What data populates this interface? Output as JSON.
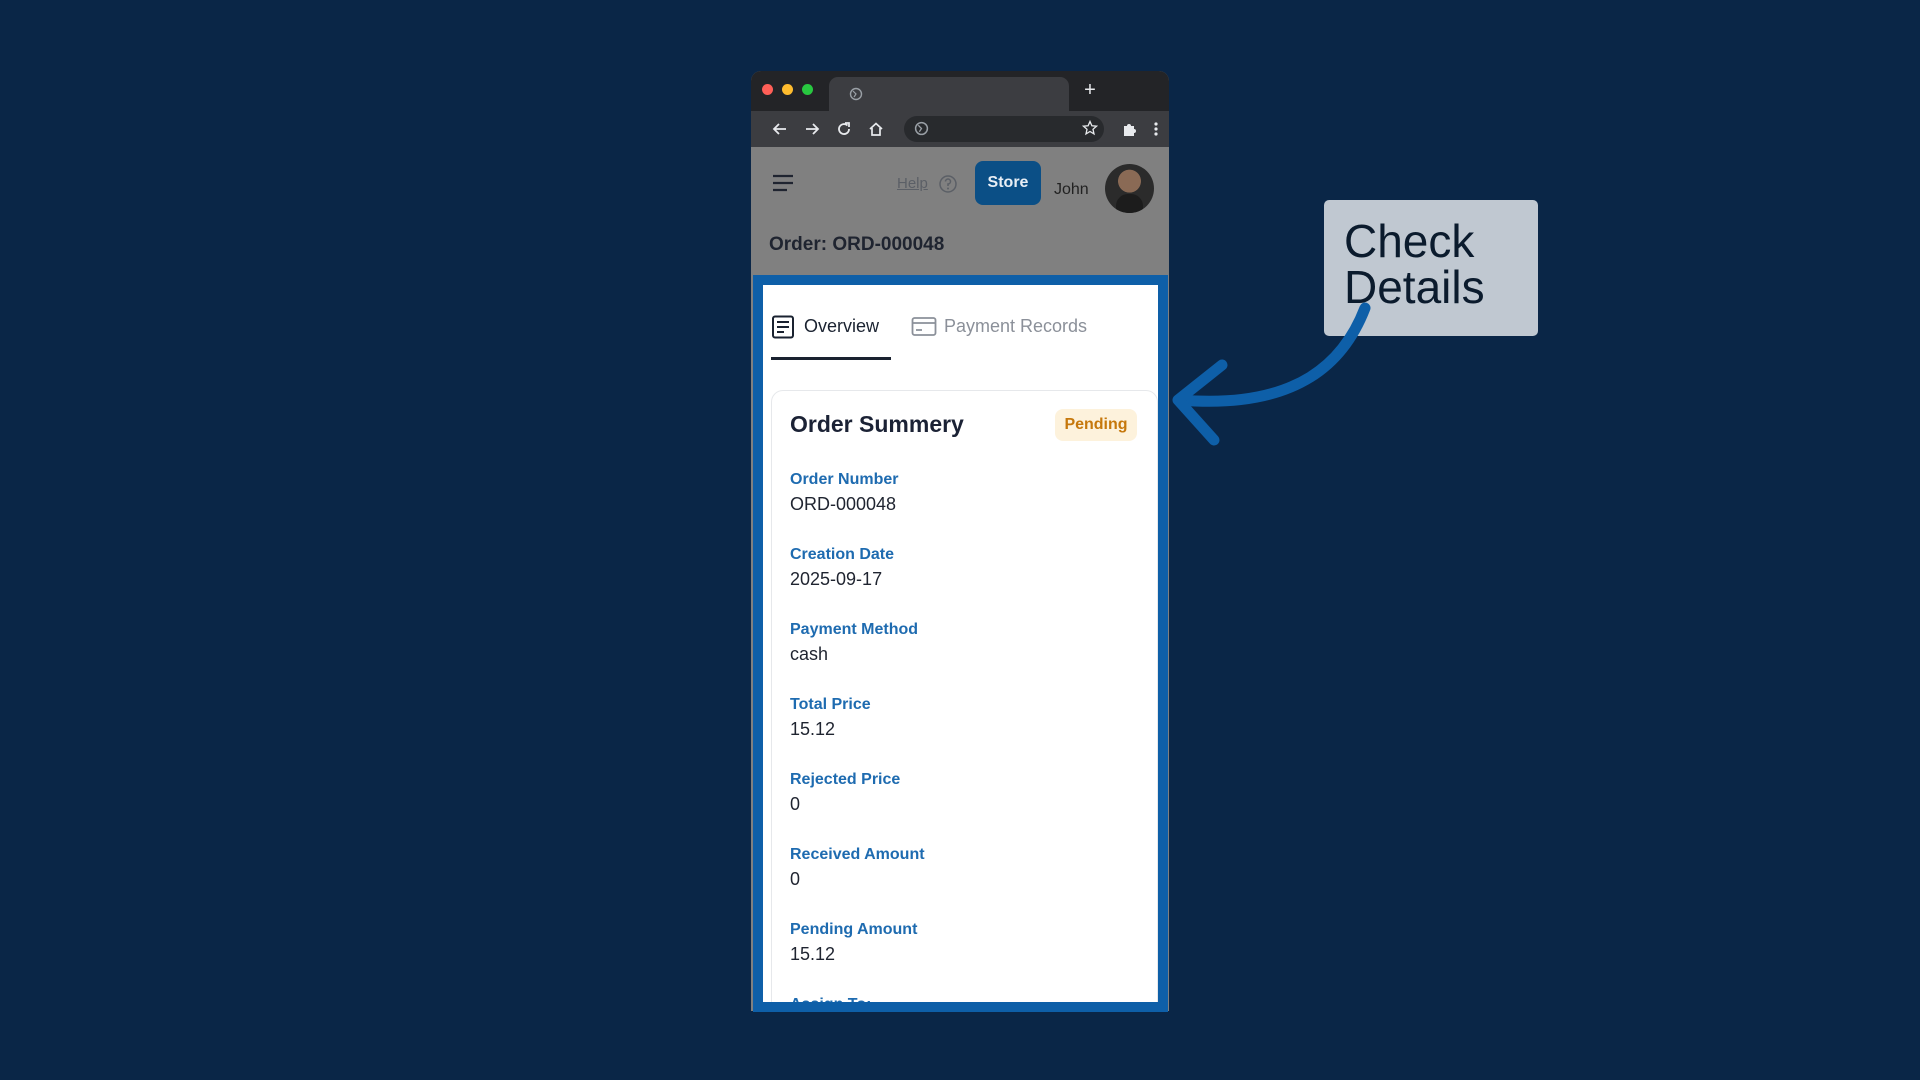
{
  "browser": {
    "new_tab_glyph": "+",
    "toolbar_icons": [
      "back-arrow-icon",
      "forward-arrow-icon",
      "reload-icon",
      "home-icon",
      "globe-icon",
      "star-icon",
      "extensions-icon",
      "more-vert-icon"
    ]
  },
  "header": {
    "menu_icon": "hamburger-icon",
    "help_label": "Help",
    "store_label": "Store",
    "user_name": "John",
    "page_title": "Order: ORD-000048"
  },
  "tabs": [
    {
      "label": "Overview",
      "icon": "document-icon",
      "active": true
    },
    {
      "label": "Payment Records",
      "icon": "card-icon",
      "active": false
    }
  ],
  "summary": {
    "title": "Order Summery",
    "status": "Pending",
    "fields": [
      {
        "label": "Order Number",
        "value": "ORD-000048"
      },
      {
        "label": "Creation Date",
        "value": "2025-09-17"
      },
      {
        "label": "Payment Method",
        "value": "cash"
      },
      {
        "label": "Total Price",
        "value": "15.12"
      },
      {
        "label": "Rejected Price",
        "value": "0"
      },
      {
        "label": "Received Amount",
        "value": "0"
      },
      {
        "label": "Pending Amount",
        "value": "15.12"
      },
      {
        "label": "Assign To:",
        "value": ""
      }
    ]
  },
  "callout": {
    "text": "Check\nDetails"
  },
  "colors": {
    "background": "#0a2647",
    "highlight": "#0e5fa8",
    "label": "#1e6bb0",
    "badge_bg": "#fdf2dc",
    "badge_text": "#c6780c",
    "store_button": "#0b4f86"
  }
}
